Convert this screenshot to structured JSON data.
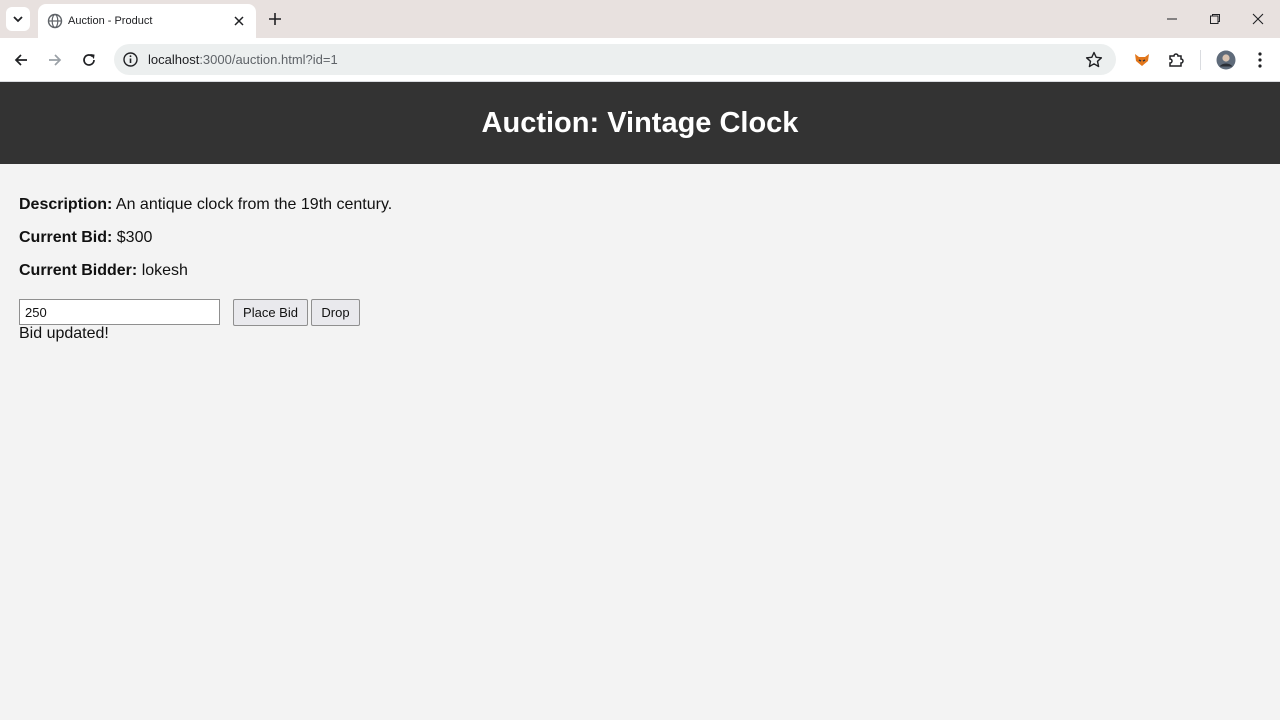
{
  "browser": {
    "tab_title": "Auction - Product",
    "url_host": "localhost",
    "url_path": ":3000/auction.html?id=1"
  },
  "page": {
    "title": "Auction: Vintage Clock",
    "description_label": "Description:",
    "description_value": "An antique clock from the 19th century.",
    "current_bid_label": "Current Bid:",
    "current_bid_value": "$300",
    "current_bidder_label": "Current Bidder:",
    "current_bidder_value": "lokesh",
    "bid_input_value": "250",
    "place_bid_label": "Place Bid",
    "drop_label": "Drop",
    "status_message": "Bid updated!"
  },
  "colors": {
    "header_bg": "#333333",
    "page_bg": "#f3f3f3",
    "tabbar_bg": "#e8e1df"
  }
}
